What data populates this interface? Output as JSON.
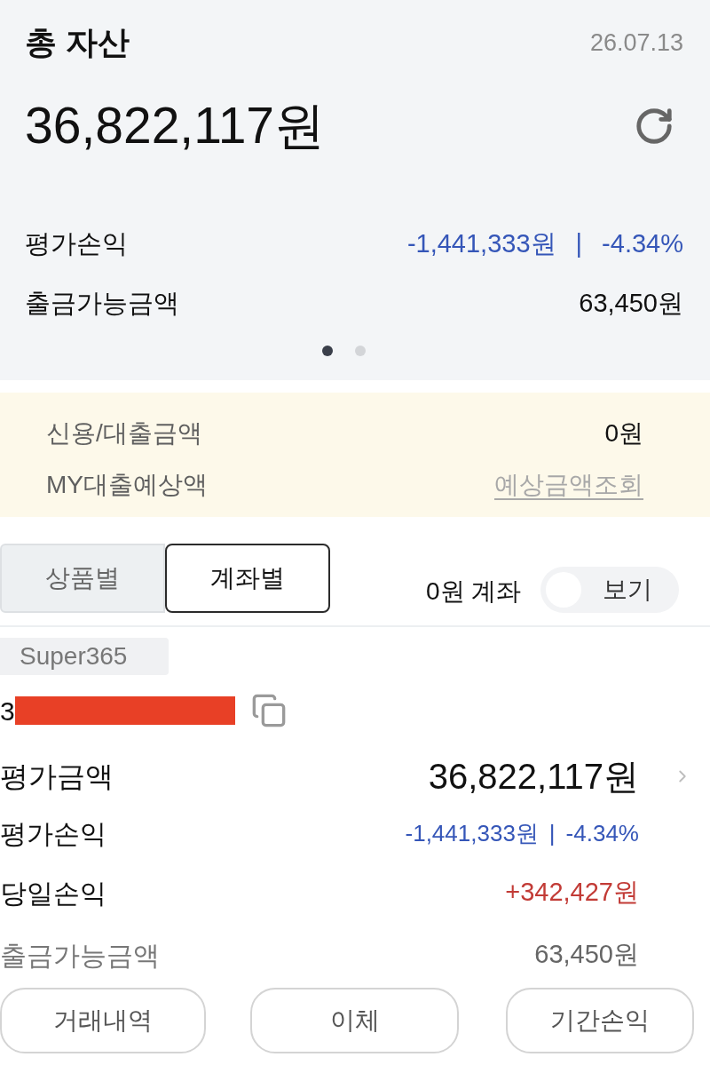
{
  "summary": {
    "title": "총 자산",
    "date": "26.07.13",
    "total": "36,822,117원",
    "rows": [
      {
        "kind": "loss",
        "label": "평가손익",
        "value": "-1,441,333원",
        "separator": "|",
        "rate": "-4.34%"
      },
      {
        "kind": "plain",
        "label": "출금가능금액",
        "value": "63,450원"
      }
    ],
    "page_dots": [
      {
        "selected": true
      },
      {
        "selected": false
      }
    ]
  },
  "loan": {
    "rows": [
      {
        "kind": "plain",
        "label": "신용/대출금액",
        "value": "0원"
      },
      {
        "kind": "link",
        "label": "MY대출예상액",
        "value": "예상금액조회"
      }
    ]
  },
  "view_tabs": [
    {
      "label": "상품별",
      "selected": false
    },
    {
      "label": "계좌별",
      "selected": true
    }
  ],
  "zero_balance_filter": {
    "label": "0원 계좌",
    "switch_label": "보기",
    "on": false
  },
  "account": {
    "product_tag": "Super365",
    "number": "3",
    "number_redacted": true,
    "rows": [
      {
        "kind": "total",
        "label": "평가금액",
        "value": "36,822,117원"
      },
      {
        "kind": "loss",
        "label": "평가손익",
        "value": "-1,441,333원",
        "separator": "|",
        "rate": "-4.34%"
      },
      {
        "kind": "gain",
        "label": "당일손익",
        "value": "+342,427원"
      },
      {
        "kind": "muted",
        "label": "출금가능금액",
        "value": "63,450원"
      }
    ]
  },
  "buttons": [
    "거래내역",
    "이체",
    "기간손익"
  ]
}
